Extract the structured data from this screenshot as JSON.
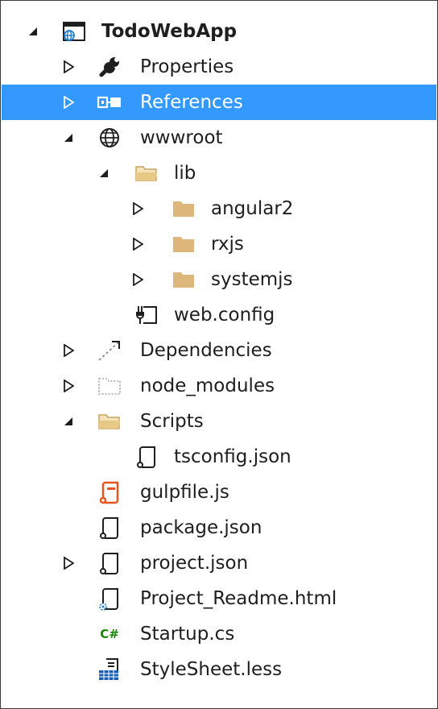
{
  "tree": {
    "root_label": "TodoWebApp",
    "items": [
      {
        "label": "Properties"
      },
      {
        "label": "References"
      },
      {
        "label": "wwwroot"
      },
      {
        "label": "lib"
      },
      {
        "label": "angular2"
      },
      {
        "label": "rxjs"
      },
      {
        "label": "systemjs"
      },
      {
        "label": "web.config"
      },
      {
        "label": "Dependencies"
      },
      {
        "label": "node_modules"
      },
      {
        "label": "Scripts"
      },
      {
        "label": "tsconfig.json"
      },
      {
        "label": "gulpfile.js"
      },
      {
        "label": "package.json"
      },
      {
        "label": "project.json"
      },
      {
        "label": "Project_Readme.html"
      },
      {
        "label": "Startup.cs"
      },
      {
        "label": "StyleSheet.less"
      }
    ],
    "selected": "References",
    "csharp_glyph": "C#"
  },
  "colors": {
    "selection": "#3399ff",
    "folder": "#dcb67a",
    "gulp": "#e8541f",
    "csharp": "#178600"
  },
  "icons": [
    "project-icon",
    "wrench-icon",
    "references-icon",
    "globe-icon",
    "folder-open-icon",
    "folder-icon",
    "config-file-icon",
    "dependencies-icon",
    "dotted-folder-icon",
    "json-file-icon",
    "gulp-file-icon",
    "html-file-icon",
    "csharp-file-icon",
    "stylesheet-icon"
  ]
}
